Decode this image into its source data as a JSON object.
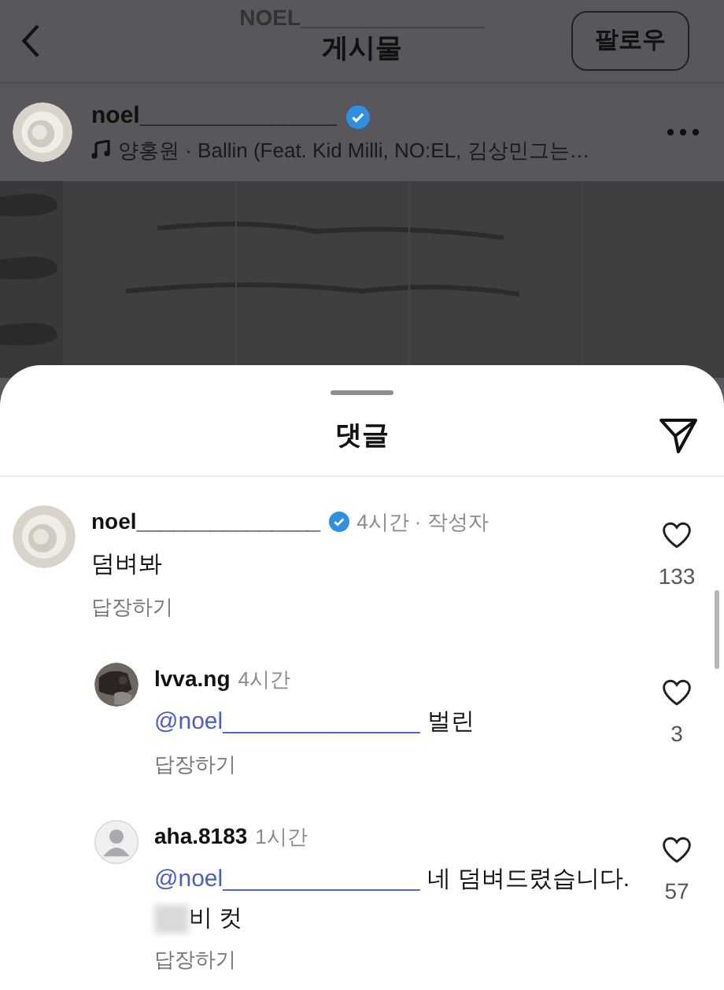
{
  "header": {
    "account": "NOEL_______________",
    "title": "게시물",
    "follow_button": "팔로우"
  },
  "post": {
    "username": "noel_______________",
    "verified": true,
    "music": "양홍원 · Ballin (Feat. Kid Milli, NO:EL, 김상민그는…"
  },
  "comments_sheet": {
    "title": "댓글",
    "comments": [
      {
        "username": "noel_______________",
        "verified": true,
        "meta": "4시간 · 작성자",
        "text": "덤벼봐",
        "reply": "답장하기",
        "likes": "133",
        "children": [
          {
            "username": "lvva.ng",
            "verified": false,
            "meta": "4시간",
            "mention": "@noel_______________",
            "text": "벌린",
            "reply": "답장하기",
            "likes": "3"
          },
          {
            "kind": "default",
            "username": "aha.8183",
            "verified": false,
            "meta": "1시간",
            "mention": "@noel_______________",
            "text": "네 덤벼드렸습니다.",
            "redacted_line": "비 컷",
            "reply": "답장하기",
            "likes": "57"
          }
        ]
      }
    ]
  }
}
